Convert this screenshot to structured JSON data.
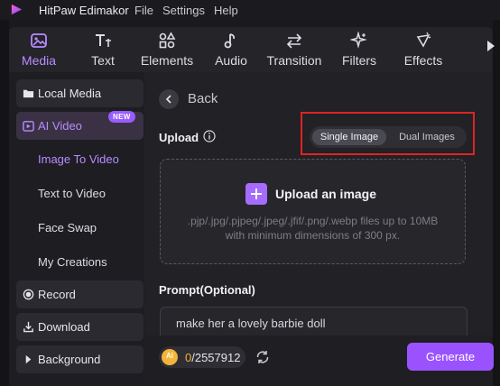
{
  "titlebar": {
    "app_title": "HitPaw Edimakor",
    "menu": [
      "File",
      "Settings",
      "Help"
    ]
  },
  "toolbar": {
    "tabs": [
      {
        "label": "Media",
        "icon": "media-icon",
        "active": true
      },
      {
        "label": "Text",
        "icon": "text-icon",
        "active": false
      },
      {
        "label": "Elements",
        "icon": "elements-icon",
        "active": false
      },
      {
        "label": "Audio",
        "icon": "audio-icon",
        "active": false
      },
      {
        "label": "Transition",
        "icon": "transition-icon",
        "active": false
      },
      {
        "label": "Filters",
        "icon": "filters-icon",
        "active": false
      },
      {
        "label": "Effects",
        "icon": "effects-icon",
        "active": false
      }
    ]
  },
  "sidebar": {
    "local_media": "Local Media",
    "ai_video": "AI Video",
    "badge": "NEW",
    "subitems": [
      "Image To Video",
      "Text to Video",
      "Face Swap",
      "My Creations"
    ],
    "record": "Record",
    "download": "Download",
    "background": "Background"
  },
  "main": {
    "back_label": "Back",
    "upload_label": "Upload",
    "modes": [
      "Single Image",
      "Dual Images"
    ],
    "selected_mode": "Single Image",
    "upload_title": "Upload an image",
    "upload_hint_1": ".pjp/.jpg/.pjpeg/.jpeg/.jfif/.png/.webp files up to 10MB",
    "upload_hint_2": "with minimum dimensions of 300 px.",
    "prompt_label": "Prompt(Optional)",
    "prompt_value": "make her a lovely barbie doll"
  },
  "footer": {
    "coin_label": "AI",
    "credits_used": "0",
    "credits_total": "/2557912",
    "generate_label": "Generate"
  },
  "colors": {
    "accent": "#9a52ff",
    "accent_text": "#b98bff",
    "highlight_border": "#e02424",
    "coin": "#f3b43a"
  }
}
